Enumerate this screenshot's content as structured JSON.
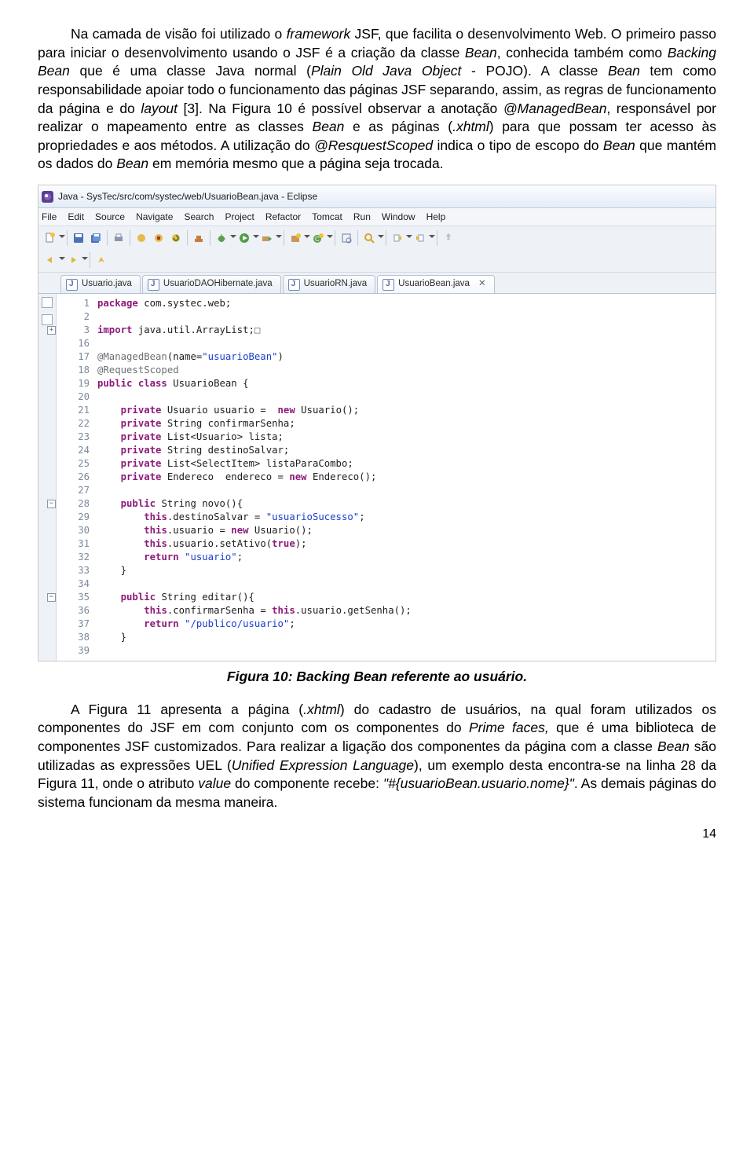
{
  "para1_a": "Na camada de visão foi utilizado o ",
  "para1_b": " JSF, que facilita o desenvolvimento Web. O primeiro passo para iniciar o desenvolvimento usando o JSF é a criação da classe ",
  "para1_c": ", conhecida também como ",
  "para1_d": " que é uma classe Java normal (",
  "para1_e": " - POJO). A classe ",
  "para1_f": " tem como responsabilidade apoiar todo o funcionamento das páginas JSF separando, assim, as regras de funcionamento da página e do ",
  "para1_g": " [3]. Na Figura 10 é possível observar a anotação ",
  "para1_h": ", responsável por realizar o mapeamento entre as classes ",
  "para1_i": " e as páginas (",
  "para1_j": ") para que possam ter acesso às propriedades e aos métodos. A utilização do ",
  "para1_k": " indica o tipo de escopo do ",
  "para1_l": " que mantém os dados do ",
  "para1_m": " em memória mesmo que a página seja trocada.",
  "it": {
    "framework": "framework",
    "Bean": "Bean",
    "Backing": "Backing Bean",
    "POJO": "Plain Old Java Object",
    "layout": "layout",
    "Managed": "@ManagedBean",
    "xhtml": ".xhtml",
    "Resquest": "@ResquestScoped"
  },
  "caption": "Figura 10: Backing Bean referente ao usuário.",
  "para2_a": "A Figura 11 apresenta a página (",
  "para2_b": ") do cadastro de usuários, na qual foram utilizados os componentes do JSF em com conjunto com os componentes do ",
  "para2_c": " que é uma biblioteca de componentes JSF customizados. Para realizar a ligação dos componentes da página com a classe ",
  "para2_d": " são utilizadas as expressões UEL (",
  "para2_e": "), um exemplo desta encontra-se na linha 28 da Figura 11, onde o atributo ",
  "para2_f": " do componente recebe: ",
  "para2_g": ". As demais páginas do sistema funcionam da mesma maneira.",
  "it2": {
    "xhtml": ".xhtml",
    "Prime": "Prime faces,",
    "Bean": "Bean",
    "UEL": "Unified Expression Language",
    "value": "value",
    "expr": "\"#{usuarioBean.usuario.nome}\""
  },
  "pagenum": "14",
  "ide": {
    "title": "Java - SysTec/src/com/systec/web/UsuarioBean.java - Eclipse",
    "menu": [
      "File",
      "Edit",
      "Source",
      "Navigate",
      "Search",
      "Project",
      "Refactor",
      "Tomcat",
      "Run",
      "Window",
      "Help"
    ],
    "tabs": [
      {
        "label": "Usuario.java",
        "active": false,
        "close": false
      },
      {
        "label": "UsuarioDAOHibernate.java",
        "active": false,
        "close": false
      },
      {
        "label": "UsuarioRN.java",
        "active": false,
        "close": false
      },
      {
        "label": "UsuarioBean.java",
        "active": true,
        "close": true
      }
    ],
    "lines": [
      {
        "n": "1",
        "fold": "",
        "html": "<span class='kw'>package</span> com.systec.web;"
      },
      {
        "n": "2",
        "fold": "",
        "html": ""
      },
      {
        "n": "3",
        "fold": "+",
        "html": "<span class='kw'>import</span> java.util.ArrayList;<span class='ann'>&#9633;</span>"
      },
      {
        "n": "16",
        "fold": "",
        "html": ""
      },
      {
        "n": "17",
        "fold": "",
        "html": "<span class='ann'>@ManagedBean</span>(name=<span class='str'>\"usuarioBean\"</span>)"
      },
      {
        "n": "18",
        "fold": "",
        "html": "<span class='ann'>@RequestScoped</span>"
      },
      {
        "n": "19",
        "fold": "",
        "html": "<span class='kw'>public class</span> UsuarioBean <span class='curly'>{</span>"
      },
      {
        "n": "20",
        "fold": "",
        "html": ""
      },
      {
        "n": "21",
        "fold": "",
        "html": "    <span class='kw'>private</span> Usuario usuario =  <span class='kw'>new</span> Usuario();"
      },
      {
        "n": "22",
        "fold": "",
        "html": "    <span class='kw'>private</span> String confirmarSenha;"
      },
      {
        "n": "23",
        "fold": "",
        "html": "    <span class='kw'>private</span> List&lt;Usuario&gt; lista;"
      },
      {
        "n": "24",
        "fold": "",
        "html": "    <span class='kw'>private</span> String destinoSalvar;"
      },
      {
        "n": "25",
        "fold": "",
        "html": "    <span class='kw'>private</span> List&lt;SelectItem&gt; listaParaCombo;"
      },
      {
        "n": "26",
        "fold": "",
        "html": "    <span class='kw'>private</span> Endereco  endereco = <span class='kw'>new</span> Endereco();"
      },
      {
        "n": "27",
        "fold": "",
        "html": ""
      },
      {
        "n": "28",
        "fold": "-",
        "html": "    <span class='kw'>public</span> String novo()<span class='curly'>{</span>"
      },
      {
        "n": "29",
        "fold": "",
        "html": "        <span class='kw'>this</span>.destinoSalvar = <span class='str'>\"usuarioSucesso\"</span>;"
      },
      {
        "n": "30",
        "fold": "",
        "html": "        <span class='kw'>this</span>.usuario = <span class='kw'>new</span> Usuario();"
      },
      {
        "n": "31",
        "fold": "",
        "html": "        <span class='kw'>this</span>.usuario.setAtivo(<span class='kw'>true</span>);"
      },
      {
        "n": "32",
        "fold": "",
        "html": "        <span class='kw'>return</span> <span class='str'>\"usuario\"</span>;"
      },
      {
        "n": "33",
        "fold": "",
        "html": "    <span class='curly'>}</span>"
      },
      {
        "n": "34",
        "fold": "",
        "html": ""
      },
      {
        "n": "35",
        "fold": "-",
        "html": "    <span class='kw'>public</span> String editar()<span class='curly'>{</span>"
      },
      {
        "n": "36",
        "fold": "",
        "html": "        <span class='kw'>this</span>.confirmarSenha = <span class='kw'>this</span>.usuario.getSenha();"
      },
      {
        "n": "37",
        "fold": "",
        "html": "        <span class='kw'>return</span> <span class='str'>\"/publico/usuario\"</span>;"
      },
      {
        "n": "38",
        "fold": "",
        "html": "    <span class='curly'>}</span>"
      },
      {
        "n": "39",
        "fold": "",
        "html": ""
      }
    ]
  }
}
